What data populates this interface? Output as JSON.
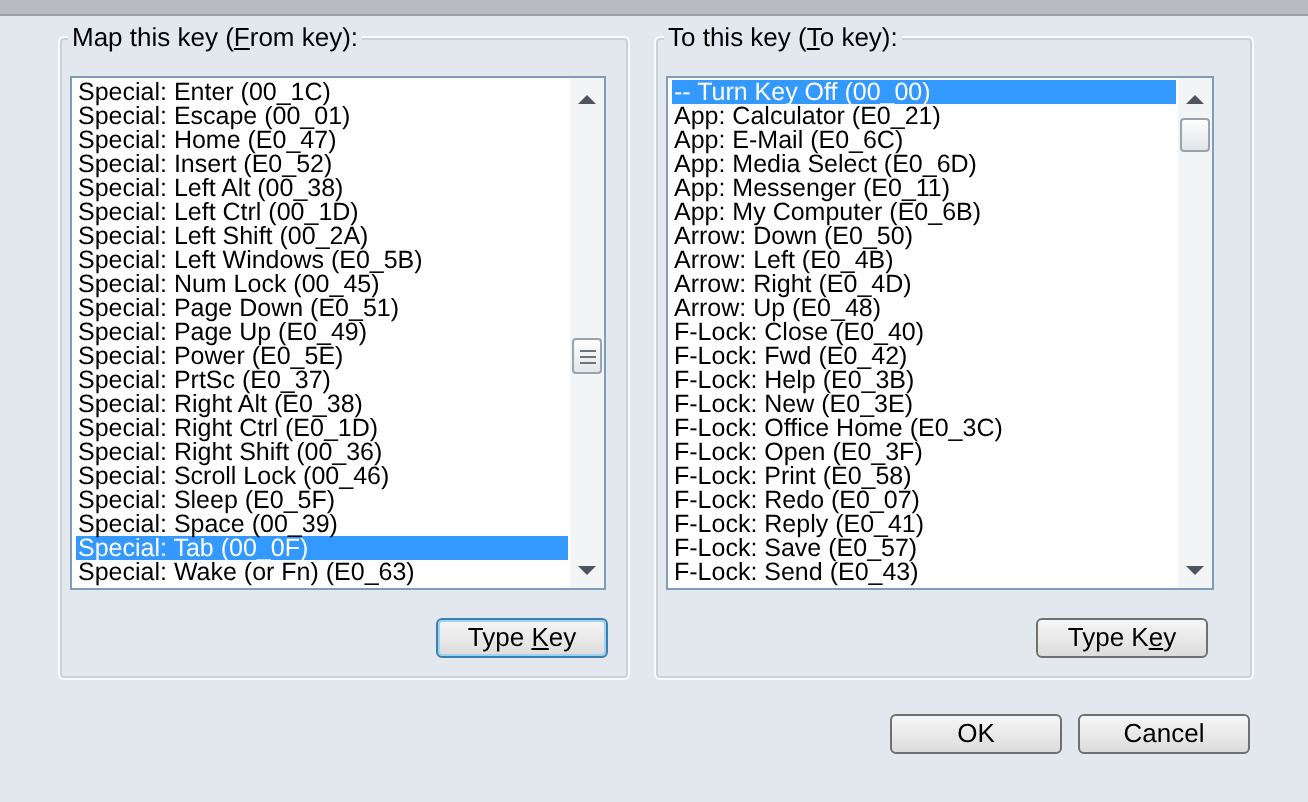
{
  "groups": [
    {
      "label": {
        "before": "Map this key (",
        "mnemonic": "F",
        "after": "rom key):"
      },
      "items": [
        {
          "text": "Special: Enter (00_1C)",
          "selected": false
        },
        {
          "text": "Special: Escape (00_01)",
          "selected": false
        },
        {
          "text": "Special: Home (E0_47)",
          "selected": false
        },
        {
          "text": "Special: Insert (E0_52)",
          "selected": false
        },
        {
          "text": "Special: Left Alt (00_38)",
          "selected": false
        },
        {
          "text": "Special: Left Ctrl (00_1D)",
          "selected": false
        },
        {
          "text": "Special: Left Shift (00_2A)",
          "selected": false
        },
        {
          "text": "Special: Left Windows (E0_5B)",
          "selected": false
        },
        {
          "text": "Special: Num Lock (00_45)",
          "selected": false
        },
        {
          "text": "Special: Page Down (E0_51)",
          "selected": false
        },
        {
          "text": "Special: Page Up (E0_49)",
          "selected": false
        },
        {
          "text": "Special: Power (E0_5E)",
          "selected": false
        },
        {
          "text": "Special: PrtSc (E0_37)",
          "selected": false
        },
        {
          "text": "Special: Right Alt (E0_38)",
          "selected": false
        },
        {
          "text": "Special: Right Ctrl (E0_1D)",
          "selected": false
        },
        {
          "text": "Special: Right Shift (00_36)",
          "selected": false
        },
        {
          "text": "Special: Scroll Lock (00_46)",
          "selected": false
        },
        {
          "text": "Special: Sleep (E0_5F)",
          "selected": false
        },
        {
          "text": "Special: Space (00_39)",
          "selected": false
        },
        {
          "text": "Special: Tab (00_0F)",
          "selected": true
        },
        {
          "text": "Special: Wake (or Fn) (E0_63)",
          "selected": false
        }
      ],
      "button": {
        "before": "Type ",
        "mnemonic": "K",
        "after": "ey",
        "focused": true
      }
    },
    {
      "label": {
        "before": "To this key (",
        "mnemonic": "T",
        "after": "o key):"
      },
      "items": [
        {
          "text": "-- Turn Key Off (00_00)",
          "selected": true
        },
        {
          "text": "App: Calculator (E0_21)",
          "selected": false
        },
        {
          "text": "App: E-Mail (E0_6C)",
          "selected": false
        },
        {
          "text": "App: Media Select (E0_6D)",
          "selected": false
        },
        {
          "text": "App: Messenger (E0_11)",
          "selected": false
        },
        {
          "text": "App: My Computer (E0_6B)",
          "selected": false
        },
        {
          "text": "Arrow: Down (E0_50)",
          "selected": false
        },
        {
          "text": "Arrow: Left (E0_4B)",
          "selected": false
        },
        {
          "text": "Arrow: Right (E0_4D)",
          "selected": false
        },
        {
          "text": "Arrow: Up (E0_48)",
          "selected": false
        },
        {
          "text": "F-Lock: Close (E0_40)",
          "selected": false
        },
        {
          "text": "F-Lock: Fwd (E0_42)",
          "selected": false
        },
        {
          "text": "F-Lock: Help (E0_3B)",
          "selected": false
        },
        {
          "text": "F-Lock: New (E0_3E)",
          "selected": false
        },
        {
          "text": "F-Lock: Office Home (E0_3C)",
          "selected": false
        },
        {
          "text": "F-Lock: Open (E0_3F)",
          "selected": false
        },
        {
          "text": "F-Lock: Print (E0_58)",
          "selected": false
        },
        {
          "text": "F-Lock: Redo (E0_07)",
          "selected": false
        },
        {
          "text": "F-Lock: Reply (E0_41)",
          "selected": false
        },
        {
          "text": "F-Lock: Save (E0_57)",
          "selected": false
        },
        {
          "text": "F-Lock: Send (E0_43)",
          "selected": false
        }
      ],
      "button": {
        "before": "Type K",
        "mnemonic": "e",
        "after": "y",
        "focused": false
      }
    }
  ],
  "buttons": [
    {
      "label": "OK"
    },
    {
      "label": "Cancel"
    }
  ]
}
